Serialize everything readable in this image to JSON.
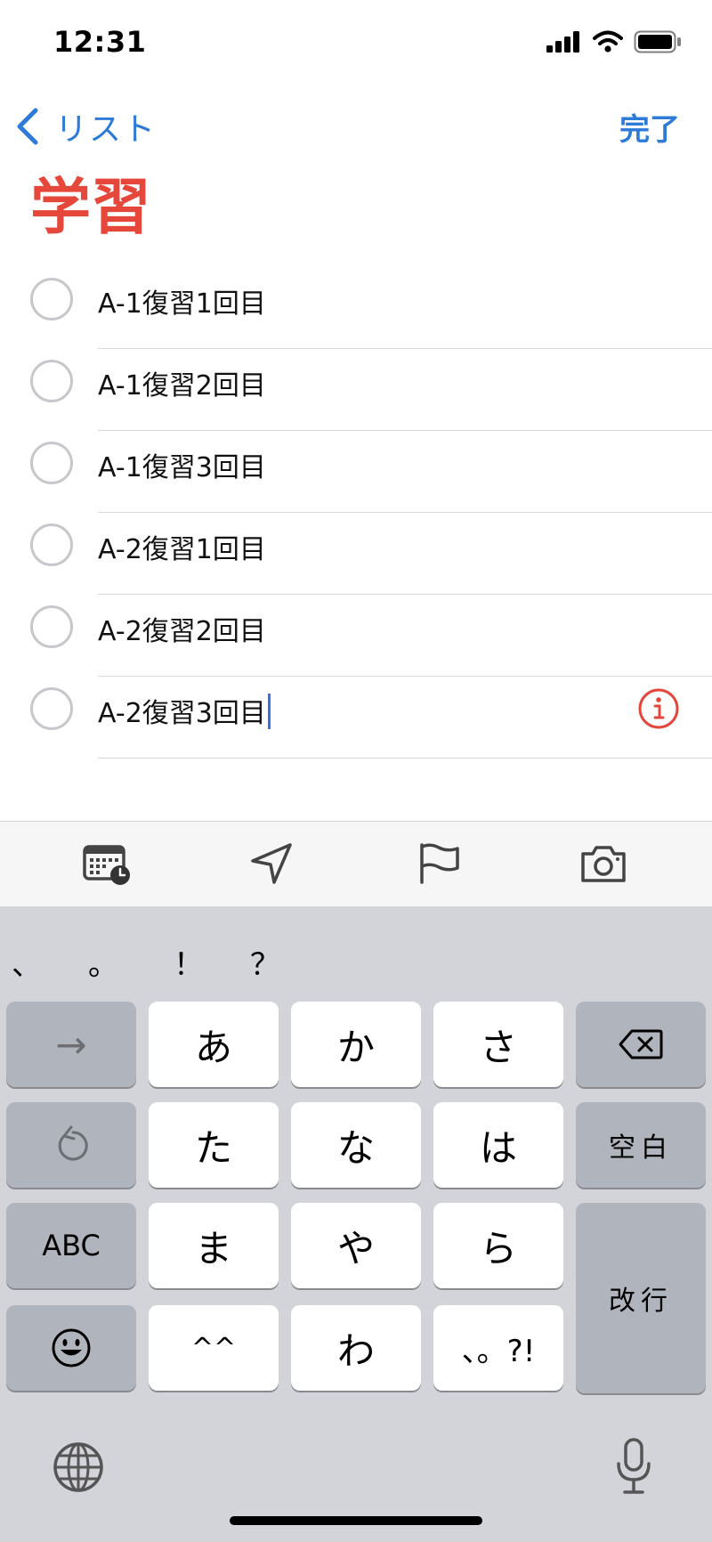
{
  "status_bar": {
    "time": "12:31"
  },
  "nav": {
    "back_label": "リスト",
    "done_label": "完了"
  },
  "list": {
    "title": "学習",
    "title_color": "#e5473b",
    "reminders": [
      {
        "text": "A-1復習1回目"
      },
      {
        "text": "A-1復習2回目"
      },
      {
        "text": "A-1復習3回目"
      },
      {
        "text": "A-2復習1回目"
      },
      {
        "text": "A-2復習2回目"
      },
      {
        "text": "A-2復習3回目",
        "editing": true
      }
    ]
  },
  "toolbar": {
    "icons": [
      "calendar-clock-icon",
      "location-arrow-icon",
      "flag-icon",
      "camera-icon"
    ]
  },
  "keyboard": {
    "punctuation": [
      "、",
      "。",
      "！",
      "？"
    ],
    "rows": [
      {
        "left": "→",
        "keys": [
          "あ",
          "か",
          "さ"
        ],
        "right": "delete"
      },
      {
        "left": "undo",
        "keys": [
          "た",
          "な",
          "は"
        ],
        "right": "空白"
      },
      {
        "left": "ABC",
        "keys": [
          "ま",
          "や",
          "ら"
        ],
        "right": "改行"
      },
      {
        "left": "emoji",
        "keys": [
          "^^",
          "わ",
          "、。?!"
        ]
      }
    ]
  },
  "colors": {
    "accent": "#2d7ad8",
    "caret": "#3b6fe6",
    "keyboard_bg": "#d3d4da"
  }
}
